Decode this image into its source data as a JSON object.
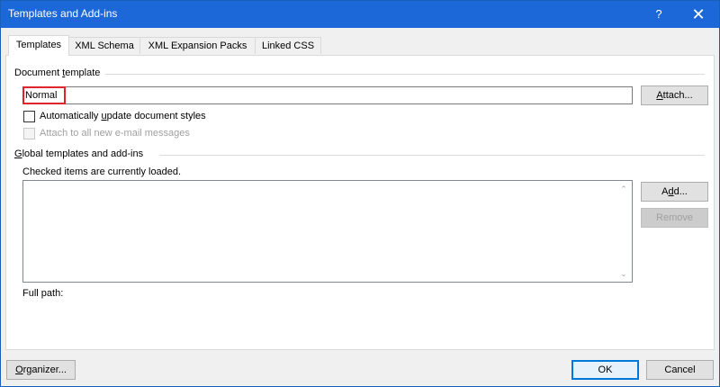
{
  "window": {
    "title": "Templates and Add-ins",
    "help_glyph": "?",
    "close_glyph": "✕"
  },
  "tabs": [
    {
      "label": "Templates",
      "active": true
    },
    {
      "label": "XML Schema",
      "active": false
    },
    {
      "label": "XML Expansion Packs",
      "active": false
    },
    {
      "label": "Linked CSS",
      "active": false
    }
  ],
  "document_template": {
    "group_label_pre": "Document ",
    "group_label_ul": "t",
    "group_label_post": "emplate",
    "value": "Normal",
    "attach_pre": "",
    "attach_ul": "A",
    "attach_post": "ttach...",
    "auto_update_pre": "Automatically ",
    "auto_update_ul": "u",
    "auto_update_post": "pdate document styles",
    "auto_update_checked": false,
    "attach_email_label": "Attach to all new e-mail messages",
    "attach_email_enabled": false
  },
  "global_templates": {
    "group_label_pre": "",
    "group_label_ul": "G",
    "group_label_post": "lobal templates and add-ins",
    "hint": "Checked items are currently loaded.",
    "items": [],
    "add_pre": "A",
    "add_ul": "d",
    "add_post": "d...",
    "remove_label": "Remove",
    "full_path_label": "Full path:"
  },
  "footer": {
    "organizer_pre": "",
    "organizer_ul": "O",
    "organizer_post": "rganizer...",
    "ok_label": "OK",
    "cancel_label": "Cancel"
  },
  "colors": {
    "titlebar": "#1c68d9",
    "highlight": "#e0242b",
    "default_button_border": "#0078d7"
  }
}
